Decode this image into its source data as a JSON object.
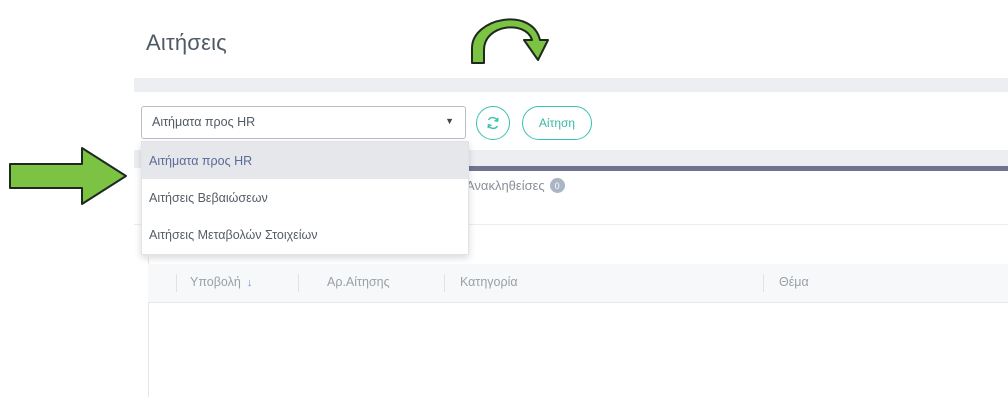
{
  "page": {
    "title": "Αιτήσεις"
  },
  "toolbar": {
    "selected_value": "Αιτήματα προς HR",
    "request_button_label": "Αίτηση",
    "accent_color": "#39c2b0"
  },
  "dropdown": {
    "options": [
      {
        "label": "Αιτήματα προς HR",
        "selected": true
      },
      {
        "label": "Αιτήσεις Βεβαιώσεων",
        "selected": false
      },
      {
        "label": "Αιτήσεις Μεταβολών Στοιχείων",
        "selected": false
      }
    ]
  },
  "tabs": {
    "visible_tab": {
      "label": "Ανακληθείσες",
      "count": "0"
    }
  },
  "table": {
    "columns": [
      "Υποβολή",
      "Αρ.Αίτησης",
      "Κατηγορία",
      "Θέμα"
    ],
    "sort_indicator": "↓",
    "rows": []
  },
  "annotations": {
    "arrow_color": "#7cc243",
    "arrow_outline": "#1f2a1f"
  }
}
